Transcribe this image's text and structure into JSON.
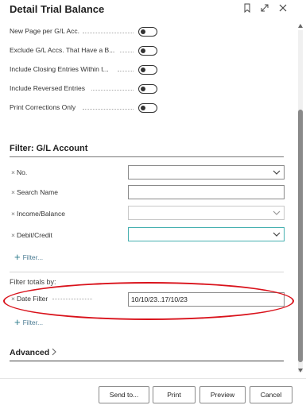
{
  "header": {
    "title": "Detail Trial Balance"
  },
  "options": [
    {
      "label": "New Page per G/L Acc."
    },
    {
      "label": "Exclude G/L Accs. That Have a B..."
    },
    {
      "label": "Include Closing Entries Within t..."
    },
    {
      "label": "Include Reversed Entries"
    },
    {
      "label": "Print Corrections Only"
    }
  ],
  "filter_section": {
    "title": "Filter: G/L Account",
    "fields": [
      {
        "label": "No.",
        "value": ""
      },
      {
        "label": "Search Name",
        "value": ""
      },
      {
        "label": "Income/Balance",
        "value": ""
      },
      {
        "label": "Debit/Credit",
        "value": ""
      }
    ],
    "add_filter_label": "Filter..."
  },
  "totals_section": {
    "title": "Filter totals by:",
    "date_filter": {
      "label": "Date Filter",
      "value": "10/10/23..17/10/23"
    },
    "add_filter_label": "Filter..."
  },
  "advanced": {
    "label": "Advanced"
  },
  "footer": {
    "send_to": "Send to...",
    "print": "Print",
    "preview": "Preview",
    "cancel": "Cancel"
  },
  "colors": {
    "highlight": "#d9121b",
    "link": "#4b7b93",
    "focus": "#46b0b0"
  },
  "icons": [
    "bookmark-icon",
    "expand-icon",
    "close-icon",
    "chevron-down-icon",
    "plus-icon",
    "chevron-right-icon"
  ]
}
